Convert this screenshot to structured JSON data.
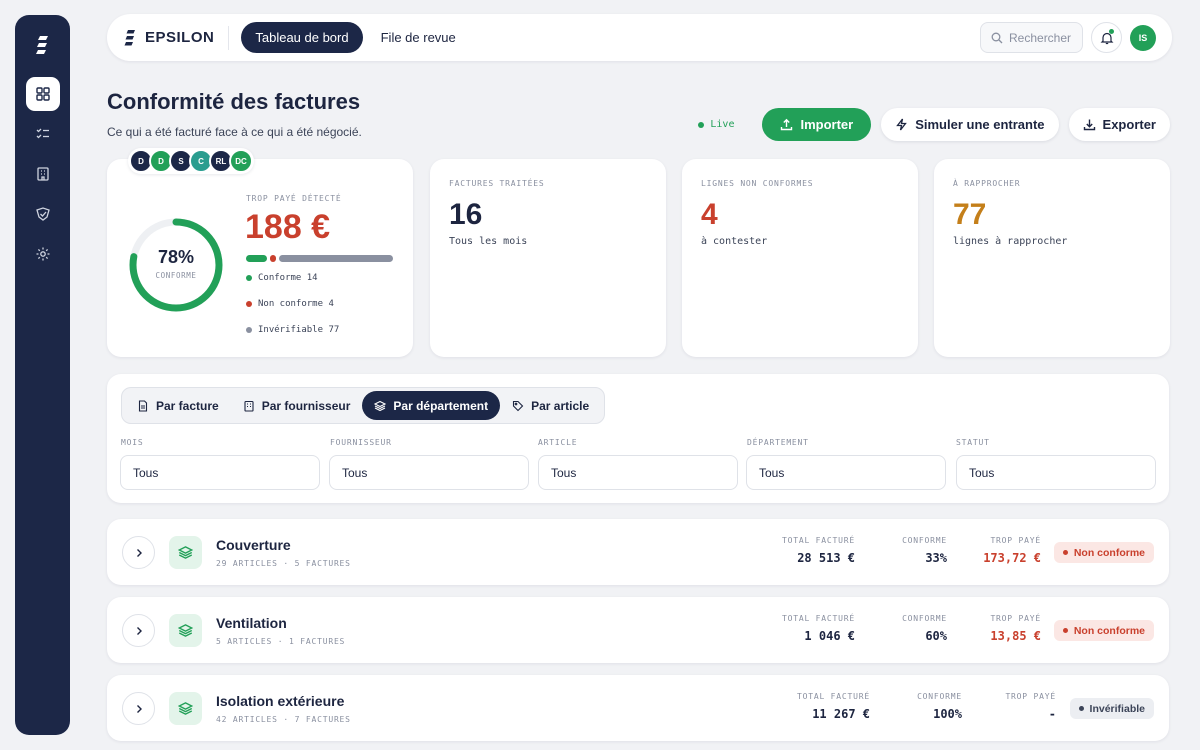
{
  "colors": {
    "navy": "#1c2747",
    "green": "#22a058",
    "red": "#c9402d",
    "amber": "#c47f1a",
    "grey": "#8a90a0"
  },
  "sidebar": {
    "items": [
      {
        "icon": "grid-icon",
        "active": true
      },
      {
        "icon": "checklist-icon",
        "active": false
      },
      {
        "icon": "building-icon",
        "active": false
      },
      {
        "icon": "shield-icon",
        "active": false
      },
      {
        "icon": "gear-icon",
        "active": false
      }
    ]
  },
  "topbar": {
    "brand": "EPSILON",
    "tabs": [
      {
        "label": "Tableau de bord",
        "active": true
      },
      {
        "label": "File de revue",
        "active": false
      }
    ],
    "search_placeholder": "Rechercher",
    "user_initials": "IS"
  },
  "header": {
    "title": "Conformité des factures",
    "subtitle": "Ce qui a été facturé face à ce qui a été négocié.",
    "live_label": "Live",
    "import_label": "Importer",
    "simulate_label": "Simuler une entrante",
    "export_label": "Exporter"
  },
  "avatar_stack": [
    {
      "initials": "D",
      "color": "#1c2747"
    },
    {
      "initials": "D",
      "color": "#22a058"
    },
    {
      "initials": "S",
      "color": "#1c2747"
    },
    {
      "initials": "C",
      "color": "#2a9d8f"
    },
    {
      "initials": "RL",
      "color": "#1c2747"
    },
    {
      "initials": "DC",
      "color": "#22a058"
    }
  ],
  "summary": {
    "conform_pct": "78%",
    "conform_fraction": 0.78,
    "conform_label": "CONFORME",
    "overpaid_label": "TROP PAYÉ DÉTECTÉ",
    "overpaid_value": "188 €",
    "segments": {
      "conforme": 14,
      "non_conforme": 4,
      "inverifiable": 77
    },
    "legend": [
      {
        "label": "Conforme 14",
        "color": "#22a058"
      },
      {
        "label": "Non conforme 4",
        "color": "#c9402d"
      },
      {
        "label": "Invérifiable 77",
        "color": "#8a90a0"
      }
    ]
  },
  "kpis": [
    {
      "label": "FACTURES TRAITÉES",
      "value": "16",
      "sub": "Tous les mois",
      "color": "#1d2540"
    },
    {
      "label": "LIGNES NON CONFORMES",
      "value": "4",
      "sub": "à contester",
      "color": "#c9402d"
    },
    {
      "label": "À RAPPROCHER",
      "value": "77",
      "sub": "lignes à rapprocher",
      "color": "#c47f1a"
    }
  ],
  "filters": {
    "tabs": [
      {
        "label": "Par facture",
        "icon": "document-icon",
        "active": false
      },
      {
        "label": "Par fournisseur",
        "icon": "building-icon",
        "active": false
      },
      {
        "label": "Par département",
        "icon": "layers-icon",
        "active": true
      },
      {
        "label": "Par article",
        "icon": "tag-icon",
        "active": false
      }
    ],
    "fields": [
      {
        "label": "MOIS",
        "value": "Tous"
      },
      {
        "label": "FOURNISSEUR",
        "value": "Tous"
      },
      {
        "label": "ARTICLE",
        "value": "Tous"
      },
      {
        "label": "DÉPARTEMENT",
        "value": "Tous"
      },
      {
        "label": "STATUT",
        "value": "Tous"
      }
    ]
  },
  "rows_header": {
    "total_label": "TOTAL FACTURÉ",
    "conform_label": "CONFORME",
    "overpaid_label": "TROP PAYÉ"
  },
  "rows": [
    {
      "title": "Couverture",
      "meta": "29 ARTICLES · 5 FACTURES",
      "total": "28 513 €",
      "conform": "33%",
      "overpaid": "173,72 €",
      "status": "Non conforme"
    },
    {
      "title": "Ventilation",
      "meta": "5 ARTICLES · 1 FACTURES",
      "total": "1 046 €",
      "conform": "60%",
      "overpaid": "13,85 €",
      "status": "Non conforme"
    },
    {
      "title": "Isolation extérieure",
      "meta": "42 ARTICLES · 7 FACTURES",
      "total": "11 267 €",
      "conform": "100%",
      "overpaid": "-",
      "status": "Invérifiable"
    }
  ]
}
